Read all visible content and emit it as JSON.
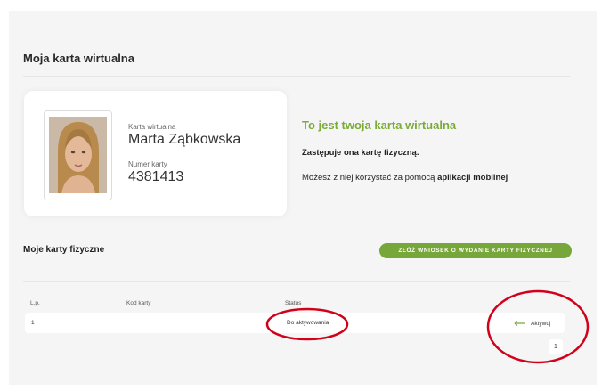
{
  "page": {
    "title": "Moja karta wirtualna"
  },
  "virtual_card": {
    "card_label": "Karta wirtualna",
    "holder_name": "Marta Ząbkowska",
    "number_label": "Numer karty",
    "number": "4381413"
  },
  "info": {
    "title": "To jest twoja karta wirtualna",
    "line1": "Zastępuje ona kartę fizyczną.",
    "line2_prefix": "Możesz z niej korzystać za pomocą ",
    "line2_bold": "aplikacji mobilnej"
  },
  "physical_cards": {
    "title": "Moje karty fizyczne",
    "apply_button": "ZŁÓŻ WNIOSEK O WYDANIE KARTY FIZYCZNEJ",
    "columns": [
      "L.p.",
      "Kod karty",
      "Status"
    ],
    "rows": [
      {
        "lp": "1",
        "code": "",
        "status": "Do aktywowania",
        "action": "Aktywuj"
      }
    ],
    "page": "1"
  },
  "colors": {
    "accent": "#77a73a",
    "annotation": "#d0021b"
  }
}
